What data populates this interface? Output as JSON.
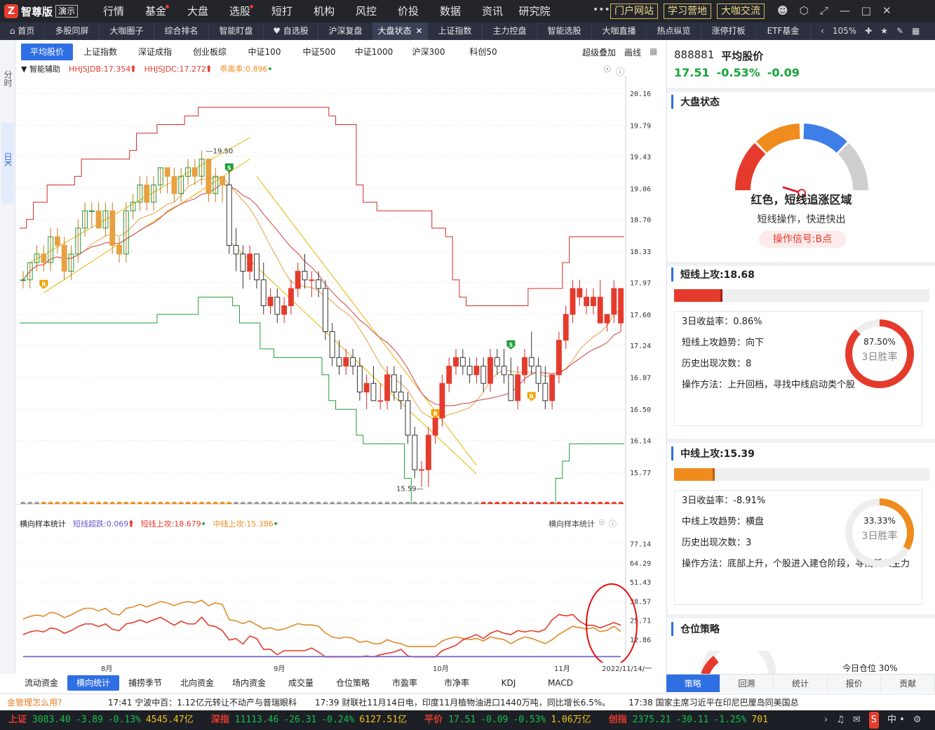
{
  "app": {
    "name": "智尊版",
    "demo_label": "演示"
  },
  "top_menu": [
    {
      "label": "行情",
      "dot": false
    },
    {
      "label": "基金",
      "dot": true
    },
    {
      "label": "大盘",
      "dot": false
    },
    {
      "label": "选股",
      "dot": true
    },
    {
      "label": "短打",
      "dot": false
    },
    {
      "label": "机构",
      "dot": false
    },
    {
      "label": "风控",
      "dot": false
    },
    {
      "label": "价投",
      "dot": false
    },
    {
      "label": "数据",
      "dot": false
    },
    {
      "label": "资讯",
      "dot": false
    },
    {
      "label": "研究院",
      "dot": false
    }
  ],
  "top_buttons": [
    "门户网站",
    "学习营地",
    "大咖交流"
  ],
  "top_more": "•••",
  "tabs": [
    {
      "label": "首页",
      "icon": "home-icon",
      "w": 64
    },
    {
      "label": "多股同屏",
      "w": 78
    },
    {
      "label": "大咖圈子",
      "w": 78
    },
    {
      "label": "综合排名",
      "w": 78
    },
    {
      "label": "智能盯盘",
      "w": 78
    },
    {
      "label": "自选股",
      "icon": "heart-icon",
      "w": 78
    },
    {
      "label": "沪深复盘",
      "w": 78
    },
    {
      "label": "大盘状态",
      "active": true,
      "close": true,
      "w": 78
    },
    {
      "label": "上证指数",
      "w": 78
    },
    {
      "label": "主力控盘",
      "w": 78
    },
    {
      "label": "智能选股",
      "w": 78
    },
    {
      "label": "大咖直播",
      "w": 78
    },
    {
      "label": "热点纵览",
      "w": 78
    },
    {
      "label": "涨停打板",
      "w": 78
    },
    {
      "label": "ETF基金",
      "w": 78
    }
  ],
  "tab_right": {
    "zoom": "105%"
  },
  "left_strip": {
    "tab1": "分时",
    "tab2": "日K"
  },
  "index_tabs": [
    {
      "label": "平均股价",
      "active": true
    },
    {
      "label": "上证指数"
    },
    {
      "label": "深证成指"
    },
    {
      "label": "创业板综"
    },
    {
      "label": "中证100"
    },
    {
      "label": "中证500"
    },
    {
      "label": "中证1000"
    },
    {
      "label": "沪深300"
    },
    {
      "label": "科创50"
    }
  ],
  "index_right": {
    "overlay": "超级叠加",
    "draw": "画线"
  },
  "indicator_line": {
    "label": "智能辅助",
    "hhjsjdb": "HHJSJDB:17.354",
    "hhjsjdc": "HHJSJDC:17.272",
    "deviation": "乖离率:0.896"
  },
  "sub_indicator_line": {
    "label": "横向样本统计",
    "ultra": "短线超跌:0.069",
    "short": "短线上攻:18.679",
    "mid": "中线上攻:15.386",
    "right_label": "横向样本统计"
  },
  "chart_data": {
    "type": "candlestick",
    "y_ticks": [
      20.16,
      19.79,
      19.43,
      19.06,
      18.7,
      18.33,
      17.97,
      17.6,
      17.24,
      16.87,
      16.5,
      16.14,
      15.77
    ],
    "ylim": [
      15.5,
      20.3
    ],
    "annotations": {
      "high": "19.50",
      "low": "15.59"
    },
    "months": [
      "8月",
      "9月",
      "10月",
      "11月"
    ],
    "date_label": "2022/11/14/一",
    "candles": [
      [
        18.0,
        18.1,
        17.9,
        18.0
      ],
      [
        18.0,
        18.2,
        17.9,
        18.2
      ],
      [
        18.2,
        18.4,
        18.1,
        18.3
      ],
      [
        18.3,
        18.4,
        18.1,
        18.2
      ],
      [
        18.2,
        18.6,
        18.1,
        18.5
      ],
      [
        18.5,
        18.6,
        18.3,
        18.4
      ],
      [
        18.4,
        18.5,
        18.0,
        18.1
      ],
      [
        18.1,
        18.4,
        18.0,
        18.3
      ],
      [
        18.3,
        18.7,
        18.2,
        18.6
      ],
      [
        18.6,
        18.9,
        18.5,
        18.8
      ],
      [
        18.8,
        18.9,
        18.6,
        18.8
      ],
      [
        18.8,
        18.9,
        18.6,
        18.6
      ],
      [
        18.6,
        18.9,
        18.5,
        18.8
      ],
      [
        18.8,
        18.9,
        18.3,
        18.4
      ],
      [
        18.4,
        18.5,
        18.2,
        18.3
      ],
      [
        18.3,
        18.9,
        18.2,
        18.8
      ],
      [
        18.8,
        19.0,
        18.7,
        18.9
      ],
      [
        18.9,
        19.2,
        18.8,
        19.1
      ],
      [
        19.1,
        19.2,
        18.8,
        18.9
      ],
      [
        18.9,
        19.2,
        18.8,
        19.1
      ],
      [
        19.1,
        19.3,
        19.0,
        19.3
      ],
      [
        19.3,
        19.3,
        19.0,
        19.2
      ],
      [
        19.2,
        19.3,
        18.9,
        19.0
      ],
      [
        19.0,
        19.3,
        18.9,
        19.2
      ],
      [
        19.2,
        19.4,
        19.1,
        19.3
      ],
      [
        19.3,
        19.4,
        19.1,
        19.2
      ],
      [
        19.2,
        19.5,
        19.1,
        19.4
      ],
      [
        19.4,
        19.4,
        18.9,
        19.0
      ],
      [
        19.0,
        19.3,
        18.9,
        19.2
      ],
      [
        19.2,
        19.2,
        18.9,
        19.1
      ],
      [
        19.1,
        19.3,
        18.3,
        18.4
      ],
      [
        18.4,
        18.6,
        18.1,
        18.3
      ],
      [
        18.3,
        18.4,
        17.9,
        18.1
      ],
      [
        18.1,
        18.4,
        18.0,
        18.3
      ],
      [
        18.3,
        18.3,
        17.9,
        18.0
      ],
      [
        18.0,
        18.2,
        17.6,
        17.7
      ],
      [
        17.7,
        17.9,
        17.6,
        17.8
      ],
      [
        17.8,
        17.9,
        17.5,
        17.6
      ],
      [
        17.6,
        17.8,
        17.5,
        17.7
      ],
      [
        17.7,
        18.0,
        17.6,
        17.9
      ],
      [
        17.9,
        18.2,
        17.8,
        18.1
      ],
      [
        18.1,
        18.3,
        17.9,
        18.0
      ],
      [
        18.0,
        18.1,
        17.8,
        18.0
      ],
      [
        18.0,
        18.1,
        17.8,
        17.9
      ],
      [
        17.9,
        18.0,
        17.3,
        17.4
      ],
      [
        17.4,
        17.5,
        17.0,
        17.1
      ],
      [
        17.1,
        17.3,
        16.9,
        17.0
      ],
      [
        17.0,
        17.2,
        16.9,
        17.1
      ],
      [
        17.1,
        17.2,
        16.9,
        17.0
      ],
      [
        17.0,
        17.1,
        16.6,
        16.7
      ],
      [
        16.7,
        16.9,
        16.5,
        16.8
      ],
      [
        16.8,
        17.0,
        16.6,
        16.6
      ],
      [
        16.6,
        16.8,
        16.5,
        16.6
      ],
      [
        16.6,
        17.0,
        16.5,
        16.9
      ],
      [
        16.9,
        17.0,
        16.6,
        16.7
      ],
      [
        16.7,
        16.9,
        16.5,
        16.6
      ],
      [
        16.6,
        16.7,
        16.1,
        16.2
      ],
      [
        16.2,
        16.3,
        15.7,
        15.8
      ],
      [
        15.8,
        15.9,
        15.6,
        15.8
      ],
      [
        15.8,
        16.3,
        15.6,
        16.2
      ],
      [
        16.2,
        16.5,
        16.1,
        16.4
      ],
      [
        16.4,
        16.9,
        16.3,
        16.8
      ],
      [
        16.8,
        17.1,
        16.7,
        17.0
      ],
      [
        17.0,
        17.2,
        16.9,
        17.1
      ],
      [
        17.1,
        17.2,
        16.9,
        17.0
      ],
      [
        17.0,
        17.1,
        16.8,
        16.9
      ],
      [
        16.9,
        17.1,
        16.8,
        17.0
      ],
      [
        17.0,
        17.1,
        16.7,
        16.8
      ],
      [
        16.8,
        17.2,
        16.7,
        17.1
      ],
      [
        17.1,
        17.2,
        16.9,
        17.0
      ],
      [
        17.0,
        17.2,
        16.8,
        16.9
      ],
      [
        16.9,
        17.1,
        16.6,
        16.6
      ],
      [
        16.6,
        17.0,
        16.5,
        16.9
      ],
      [
        16.9,
        17.2,
        16.8,
        17.1
      ],
      [
        17.1,
        17.4,
        16.9,
        17.0
      ],
      [
        17.0,
        17.1,
        16.7,
        16.8
      ],
      [
        16.8,
        17.0,
        16.5,
        16.6
      ],
      [
        16.6,
        16.9,
        16.5,
        16.9
      ],
      [
        16.9,
        17.4,
        16.8,
        17.3
      ],
      [
        17.3,
        17.7,
        17.2,
        17.6
      ],
      [
        17.6,
        18.0,
        17.5,
        17.9
      ],
      [
        17.9,
        18.0,
        17.7,
        17.8
      ],
      [
        17.8,
        17.9,
        17.6,
        17.7
      ],
      [
        17.7,
        17.9,
        17.6,
        17.8
      ],
      [
        17.8,
        18.0,
        17.5,
        17.5
      ],
      [
        17.5,
        17.6,
        17.4,
        17.6
      ],
      [
        17.6,
        18.0,
        17.5,
        17.9
      ],
      [
        17.9,
        17.9,
        17.4,
        17.5
      ]
    ],
    "sub_y_ticks": [
      77.14,
      64.29,
      51.43,
      38.57,
      25.71,
      12.86
    ],
    "sub_ylim": [
      0,
      85
    ]
  },
  "bottom_tabs": [
    "流动资金",
    "横向统计",
    "捕捞季节",
    "北向资金",
    "场内资金",
    "成交量",
    "仓位策略",
    "市盈率",
    "市净率",
    "KDJ",
    "MACD"
  ],
  "right_panel": {
    "code": "888881",
    "name": "平均股价",
    "price": "17.51",
    "pct": "-0.53%",
    "change": "-0.09",
    "market_status_title": "大盘状态",
    "gauge_text": "红色，短线追涨区域",
    "gauge_sub": "短线操作，快进快出",
    "signal": "操作信号:B点",
    "short_title": "短线上攻:18.68",
    "short_fill": 0.19,
    "short_rows": [
      "3日收益率：0.86%",
      "短线上攻趋势：向下",
      "历史出现次数：8",
      "操作方法：上升回档，寻找中线启动类个股"
    ],
    "short_rate": "87.50%",
    "short_rate_value": 0.875,
    "short_rate_label": "3日胜率",
    "mid_title": "中线上攻:15.39",
    "mid_fill": 0.16,
    "mid_rows": [
      "3日收益率：-8.91%",
      "中线上攻趋势：横盘",
      "历史出现次数：3",
      "操作方法：底部上升，个股进入建仓阶段，寻找新入主力"
    ],
    "mid_rate": "33.33%",
    "mid_rate_value": 0.3333,
    "mid_rate_label": "3日胜率",
    "position_title": "仓位策略",
    "position_today": "今日仓位 30%",
    "tabs": [
      "策略",
      "回溯",
      "统计",
      "报价",
      "贡献"
    ]
  },
  "news": {
    "help": "金管理怎么用?",
    "items": [
      "17:41  宁波中百：1.12亿元转让不动产与普瑞眼科",
      "17:39  财联社11月14日电，印度11月植物油进口1440万吨，同比增长6.5%。",
      "17:38  国家主席习近平在印尼巴厘岛同美国总"
    ]
  },
  "status_bar": [
    {
      "name": "上证",
      "price": "3083.40",
      "chg": "-3.89",
      "pct": "-0.13%",
      "amt": "4545.47亿"
    },
    {
      "name": "深指",
      "price": "11113.46",
      "chg": "-26.31",
      "pct": "-0.24%",
      "amt": "6127.51亿"
    },
    {
      "name": "平价",
      "price": "17.51",
      "chg": "-0.09",
      "pct": "-0.53%",
      "amt": "1.06万亿"
    },
    {
      "name": "创指",
      "price": "2375.21",
      "chg": "-30.11",
      "pct": "-1.25%",
      "amt": "701"
    }
  ],
  "colors": {
    "up": "#e53b2c",
    "down": "#13a538",
    "accent": "#2f6fe4",
    "orange": "#f08c1e"
  }
}
